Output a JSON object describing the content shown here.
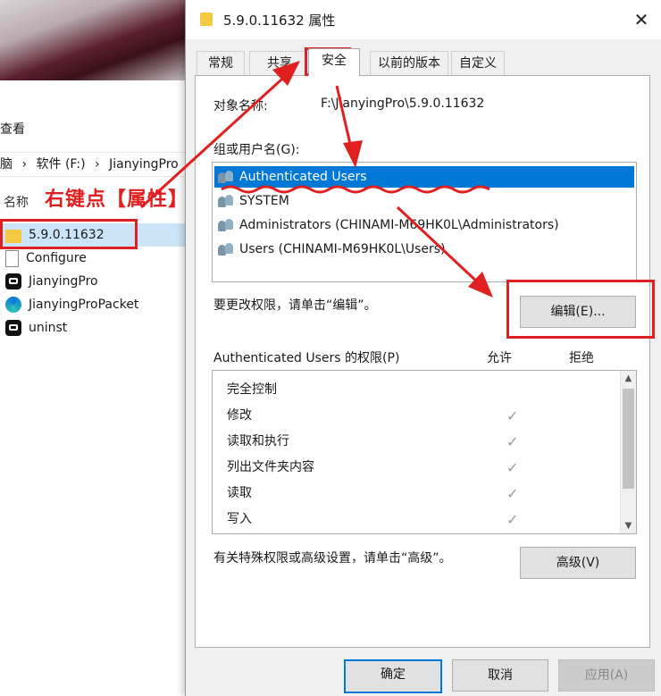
{
  "explorer": {
    "view_label": "查看",
    "breadcrumb": [
      "脑",
      "›",
      "软件 (F:)",
      "›",
      "JianyingPro"
    ],
    "column_name": "名称",
    "files": [
      {
        "name": "5.9.0.11632",
        "icon": "folder-icon",
        "selected": true
      },
      {
        "name": "Configure",
        "icon": "document-icon"
      },
      {
        "name": "JianyingPro",
        "icon": "capcut-icon"
      },
      {
        "name": "JianyingProPacket",
        "icon": "edge-icon"
      },
      {
        "name": "uninst",
        "icon": "capcut-icon"
      }
    ]
  },
  "dialog": {
    "title": "5.9.0.11632 属性",
    "close_glyph": "✕",
    "tabs": [
      "常规",
      "共享",
      "安全",
      "以前的版本",
      "自定义"
    ],
    "active_tab": "安全",
    "object_name_label": "对象名称:",
    "object_name_value": "F:\\JianyingPro\\5.9.0.11632",
    "group_label": "组或用户名(G):",
    "groups": [
      "Authenticated Users",
      "SYSTEM",
      "Administrators (CHINAMI-M69HK0L\\Administrators)",
      "Users (CHINAMI-M69HK0L\\Users)"
    ],
    "change_perm_text": "要更改权限，请单击“编辑”。",
    "edit_button": "编辑(E)...",
    "perm_header": "Authenticated Users 的权限(P)",
    "allow_label": "允许",
    "deny_label": "拒绝",
    "permissions": [
      "完全控制",
      "修改",
      "读取和执行",
      "列出文件夹内容",
      "读取",
      "写入"
    ],
    "check_glyph": "✓",
    "advanced_text": "有关特殊权限或高级设置，请单击“高级”。",
    "advanced_button": "高级(V)",
    "ok_button": "确定",
    "cancel_button": "取消",
    "apply_button": "应用(A)"
  },
  "annotation": {
    "text": "右键点【属性】",
    "color": "#e02020"
  },
  "colors": {
    "selection": "#0078d7",
    "explorer_selection": "#cce4f7",
    "folder": "#f5c842"
  }
}
